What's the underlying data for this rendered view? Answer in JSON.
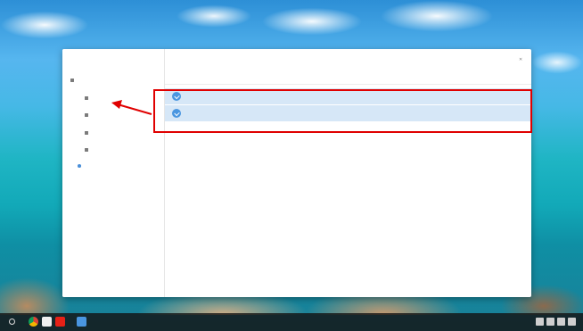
{
  "window": {
    "sidebar_title": "",
    "breadcrumb": "",
    "toolbar_action": ""
  },
  "sidebar": {
    "items": [
      {
        "label": "",
        "active": false
      },
      {
        "label": "",
        "active": false
      },
      {
        "label": "",
        "active": false
      },
      {
        "label": "",
        "active": false
      },
      {
        "label": "",
        "active": false
      },
      {
        "label": "",
        "active": true
      }
    ]
  },
  "file_list": {
    "columns": [
      "",
      "",
      "",
      ""
    ],
    "rows": [
      {
        "name": "",
        "size": "",
        "type": "",
        "date": ""
      },
      {
        "name": "",
        "size": "",
        "type": "",
        "date": ""
      }
    ]
  },
  "colors": {
    "annotation": "#e00000",
    "selection": "#d6e7f7",
    "accent": "#4a96e0"
  },
  "icons": [
    "launcher-icon",
    "chrome-icon",
    "gmail-icon",
    "youtube-icon",
    "files-icon",
    "folder-icon",
    "check-icon",
    "close-icon"
  ]
}
